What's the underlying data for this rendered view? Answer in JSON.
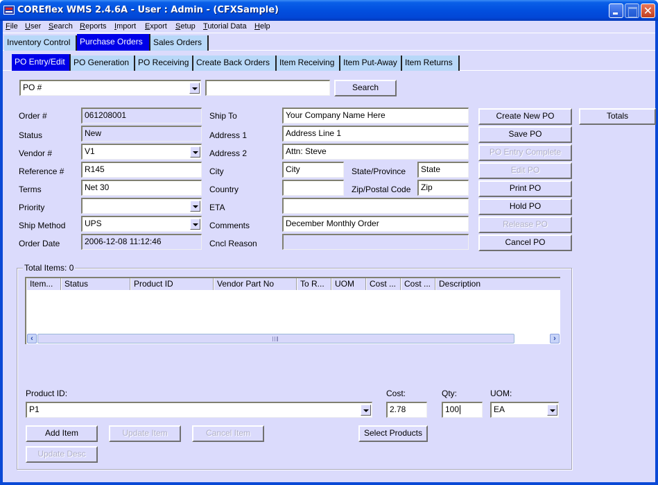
{
  "window": {
    "title": "COREflex WMS 2.4.6A - User : Admin - (CFXSample)",
    "controls": {
      "minimize": "minimize",
      "maximize": "maximize",
      "close": "✕"
    }
  },
  "menu": [
    {
      "label": "File",
      "mnemonic": "F",
      "rest": "ile"
    },
    {
      "label": "User",
      "mnemonic": "U",
      "rest": "ser"
    },
    {
      "label": "Search",
      "mnemonic": "S",
      "rest": "earch"
    },
    {
      "label": "Reports",
      "mnemonic": "R",
      "rest": "eports"
    },
    {
      "label": "Import",
      "mnemonic": "I",
      "rest": "mport"
    },
    {
      "label": "Export",
      "mnemonic": "E",
      "rest": "xport"
    },
    {
      "label": "Setup",
      "mnemonic": "S",
      "rest": "etup"
    },
    {
      "label": "Tutorial Data",
      "mnemonic": "T",
      "rest": "utorial Data"
    },
    {
      "label": "Help",
      "mnemonic": "H",
      "rest": "elp"
    }
  ],
  "main_tabs": [
    {
      "label": "Inventory Control",
      "active": false
    },
    {
      "label": "Purchase Orders",
      "active": true
    },
    {
      "label": "Sales Orders",
      "active": false
    }
  ],
  "sub_tabs": [
    {
      "label": "PO Entry/Edit",
      "active": true
    },
    {
      "label": "PO Generation",
      "active": false
    },
    {
      "label": "PO Receiving",
      "active": false
    },
    {
      "label": "Create Back Orders",
      "active": false
    },
    {
      "label": "Item Receiving",
      "active": false
    },
    {
      "label": "Item Put-Away",
      "active": false
    },
    {
      "label": "Item Returns",
      "active": false
    }
  ],
  "search": {
    "field_select": "PO #",
    "query": "",
    "button": "Search"
  },
  "order": {
    "order_no": {
      "label": "Order #",
      "value": "061208001"
    },
    "status": {
      "label": "Status",
      "value": "New"
    },
    "vendor": {
      "label": "Vendor #",
      "value": "V1"
    },
    "reference": {
      "label": "Reference #",
      "value": "R145"
    },
    "terms": {
      "label": "Terms",
      "value": "Net 30"
    },
    "priority": {
      "label": "Priority",
      "value": ""
    },
    "ship_method": {
      "label": "Ship Method",
      "value": "UPS"
    },
    "order_date": {
      "label": "Order Date",
      "value": "2006-12-08 11:12:46"
    }
  },
  "ship": {
    "ship_to": {
      "label": "Ship To",
      "value": "Your Company Name Here"
    },
    "address1": {
      "label": "Address 1",
      "value": "Address Line 1"
    },
    "address2": {
      "label": "Address 2",
      "value": "Attn: Steve"
    },
    "city": {
      "label": "City",
      "value": "City"
    },
    "state": {
      "label": "State/Province",
      "value": "State"
    },
    "country": {
      "label": "Country",
      "value": ""
    },
    "zip": {
      "label": "Zip/Postal Code",
      "value": "Zip"
    },
    "eta": {
      "label": "ETA",
      "value": ""
    },
    "comments": {
      "label": "Comments",
      "value": "December Monthly Order"
    },
    "cancel_reason": {
      "label": "Cncl Reason",
      "value": ""
    }
  },
  "actions": {
    "create_new_po": {
      "label": "Create New PO",
      "enabled": true
    },
    "save_po": {
      "label": "Save PO",
      "enabled": true
    },
    "po_entry_complete": {
      "label": "PO Entry Complete",
      "enabled": false
    },
    "edit_po": {
      "label": "Edit PO",
      "enabled": false
    },
    "print_po": {
      "label": "Print PO",
      "enabled": true
    },
    "hold_po": {
      "label": "Hold PO",
      "enabled": true
    },
    "release_po": {
      "label": "Release PO",
      "enabled": false
    },
    "cancel_po": {
      "label": "Cancel PO",
      "enabled": true
    },
    "totals": {
      "label": "Totals",
      "enabled": true
    }
  },
  "items": {
    "group_title": "Total Items: 0",
    "columns": [
      "Item...",
      "Status",
      "Product ID",
      "Vendor Part No",
      "To R...",
      "UOM",
      "Cost ...",
      "Cost ...",
      "Description"
    ],
    "rows": []
  },
  "item_entry": {
    "product_id": {
      "label": "Product ID:",
      "value": "P1"
    },
    "cost": {
      "label": "Cost:",
      "value": "2.78"
    },
    "qty": {
      "label": "Qty:",
      "value": "100"
    },
    "uom": {
      "label": "UOM:",
      "value": "EA"
    },
    "add_item": {
      "label": "Add Item",
      "enabled": true
    },
    "update_item": {
      "label": "Update Item",
      "enabled": false
    },
    "cancel_item": {
      "label": "Cancel Item",
      "enabled": false
    },
    "select_products": {
      "label": "Select Products",
      "enabled": true
    },
    "update_desc": {
      "label": "Update Desc",
      "enabled": false
    }
  }
}
